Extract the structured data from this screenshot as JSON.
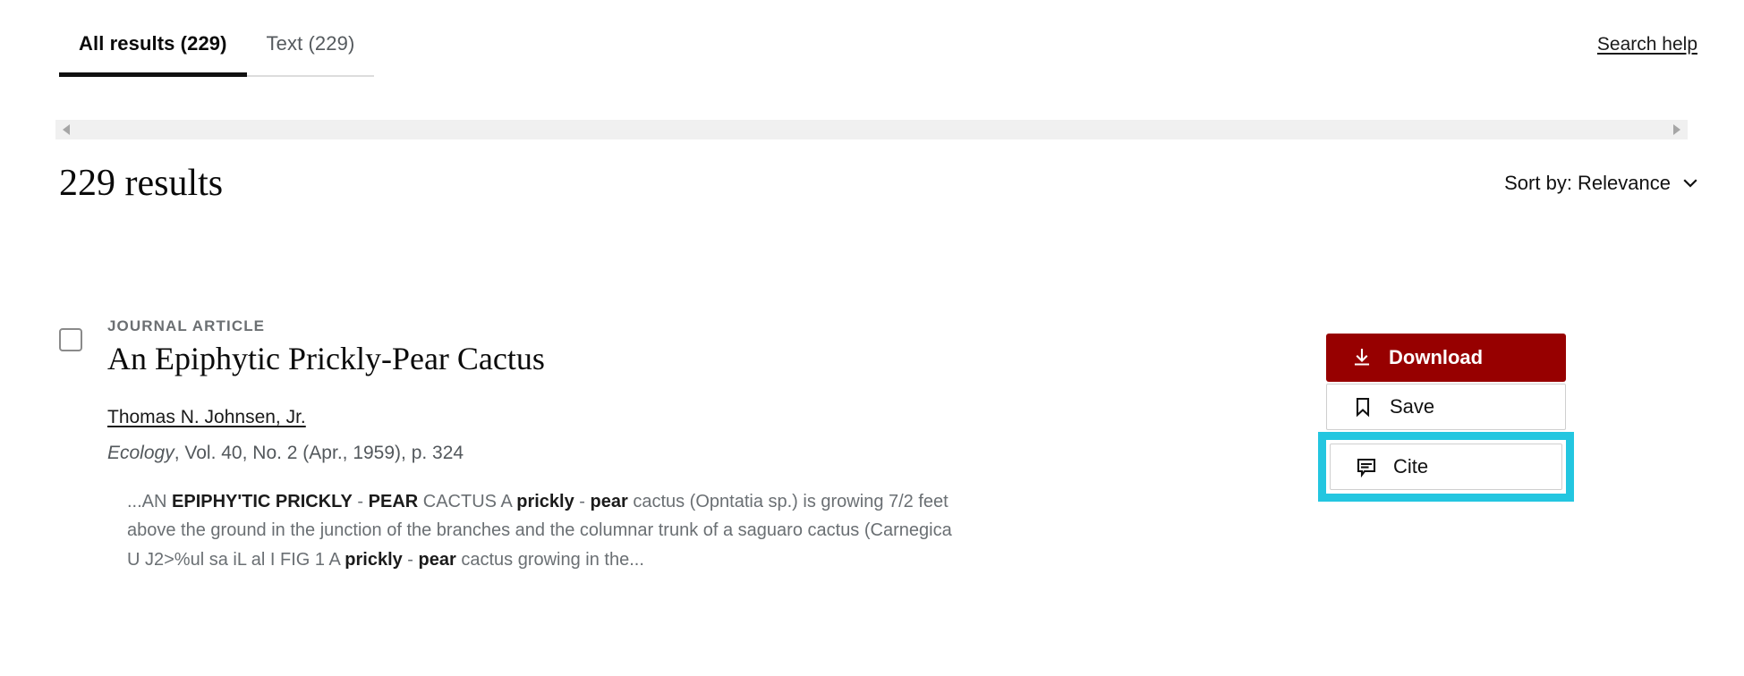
{
  "tabs": [
    {
      "label": "All results (229)",
      "active": true,
      "name": "tab-all-results"
    },
    {
      "label": "Text (229)",
      "active": false,
      "name": "tab-text"
    }
  ],
  "header": {
    "search_help": "Search help"
  },
  "scrollbar": {
    "left_arrow": "scroll-left-arrow",
    "right_arrow": "scroll-right-arrow"
  },
  "results_header": {
    "count_label": "229 results",
    "sort_label": "Sort by: Relevance"
  },
  "result": {
    "kicker": "JOURNAL ARTICLE",
    "title": "An Epiphytic Prickly-Pear Cactus",
    "authors": "Thomas N. Johnsen, Jr.",
    "citation_journal": "Ecology",
    "citation_rest": ", Vol. 40, No. 2 (Apr., 1959), p. 324",
    "snippet_parts": [
      {
        "text": "...AN ",
        "bold": false
      },
      {
        "text": "EPIPHY'TIC PRICKLY",
        "bold": true
      },
      {
        "text": " - ",
        "bold": false
      },
      {
        "text": "PEAR",
        "bold": true
      },
      {
        "text": " CACTUS A ",
        "bold": false
      },
      {
        "text": "prickly",
        "bold": true
      },
      {
        "text": " - ",
        "bold": false
      },
      {
        "text": "pear",
        "bold": true
      },
      {
        "text": " cactus (Opntatia sp.) is growing 7/2 feet above the ground in the junction of the branches and the columnar trunk of a saguaro cactus (Carnegica U J2>%ul sa iL al I FIG 1 A ",
        "bold": false
      },
      {
        "text": "prickly",
        "bold": true
      },
      {
        "text": " - ",
        "bold": false
      },
      {
        "text": "pear",
        "bold": true
      },
      {
        "text": " cactus growing in the...",
        "bold": false
      }
    ]
  },
  "actions": {
    "download_label": "Download",
    "save_label": "Save",
    "cite_label": "Cite"
  },
  "colors": {
    "download_red": "#970000",
    "highlight_cyan": "#23c6e0",
    "accent_text": "#1a1a1a"
  }
}
